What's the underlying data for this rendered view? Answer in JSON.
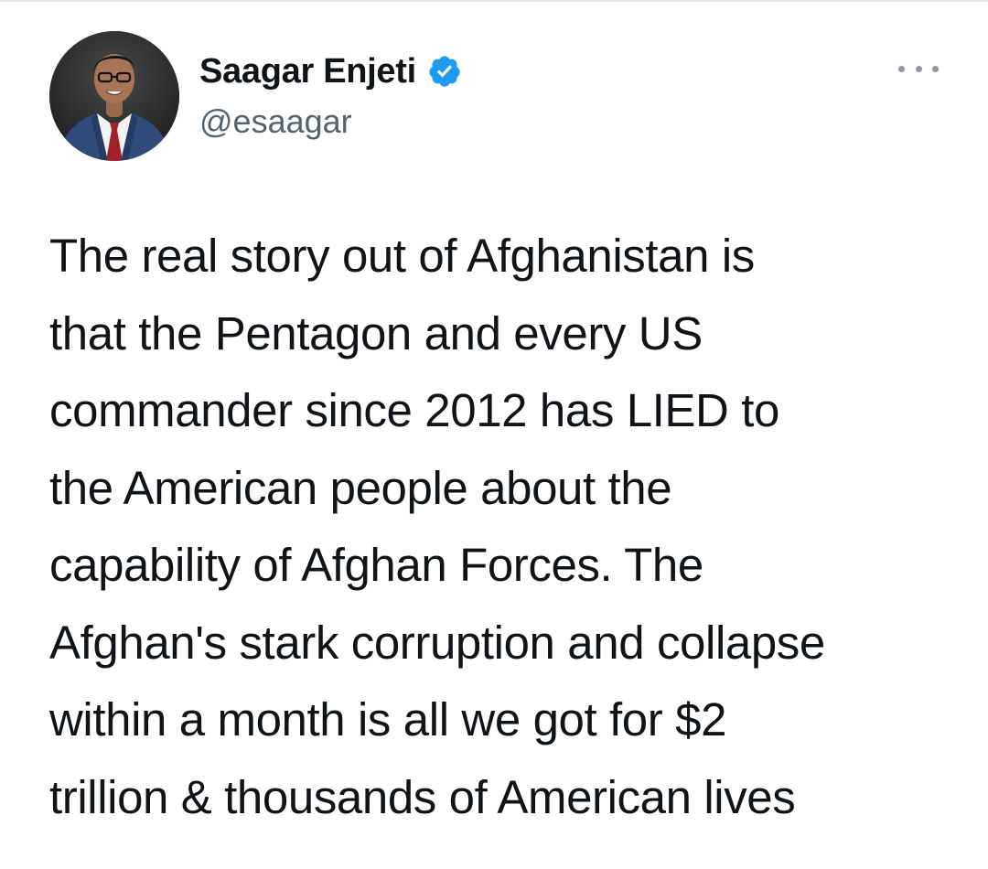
{
  "author": {
    "display_name": "Saagar Enjeti",
    "handle": "@esaagar",
    "verified": true,
    "avatar_icon": "profile-photo"
  },
  "actions": {
    "more_icon": "more-horizontal-icon"
  },
  "tweet": {
    "lines": [
      "The real story out of Afghanistan is",
      "that the Pentagon and every US",
      "commander since 2012 has LIED to",
      "the American people about the",
      "capability of Afghan Forces. The",
      "Afghan's stark corruption and collapse",
      "within a month is all we got for $2",
      "trillion & thousands of American lives"
    ]
  },
  "colors": {
    "text": "#0f1419",
    "secondary_text": "#536471",
    "verified_badge": "#1d9bf0",
    "background": "#ffffff"
  }
}
